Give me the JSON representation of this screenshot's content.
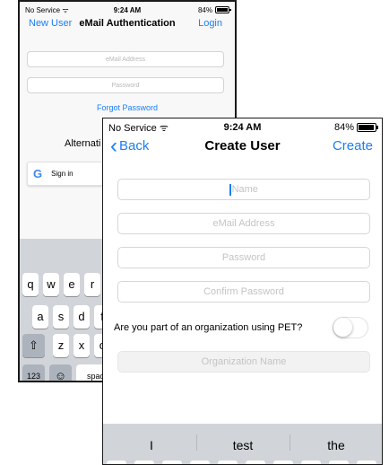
{
  "back": {
    "status": {
      "carrier": "No Service",
      "time": "9:24 AM",
      "battery": "84%",
      "battery_level": 0.84
    },
    "nav": {
      "left": "New User",
      "title": "eMail Authentication",
      "right": "Login"
    },
    "email_placeholder": "eMail Address",
    "password_placeholder": "Password",
    "forgot": "Forgot Password",
    "alternative": "Alternati",
    "google_label": "Sign in",
    "google_glyph": "G",
    "keys_row1": [
      "q",
      "w",
      "e",
      "r"
    ],
    "keys_row2": [
      "a",
      "s",
      "d",
      "f"
    ],
    "keys_row3": [
      "z",
      "x",
      "c"
    ],
    "key_shift": "⇧",
    "key_123": "123",
    "key_emoji": "☺",
    "key_space": "spac"
  },
  "front": {
    "status": {
      "carrier": "No Service",
      "time": "9:24 AM",
      "battery": "84%",
      "battery_level": 0.84
    },
    "nav": {
      "back": "Back",
      "title": "Create User",
      "right": "Create"
    },
    "name_placeholder": "Name",
    "email_placeholder": "eMail Address",
    "password_placeholder": "Password",
    "confirm_placeholder": "Confirm Password",
    "org_question": "Are you part of an organization using PET?",
    "org_toggle_on": false,
    "org_placeholder": "Organization Name",
    "suggestions": [
      "I",
      "test",
      "the"
    ]
  }
}
